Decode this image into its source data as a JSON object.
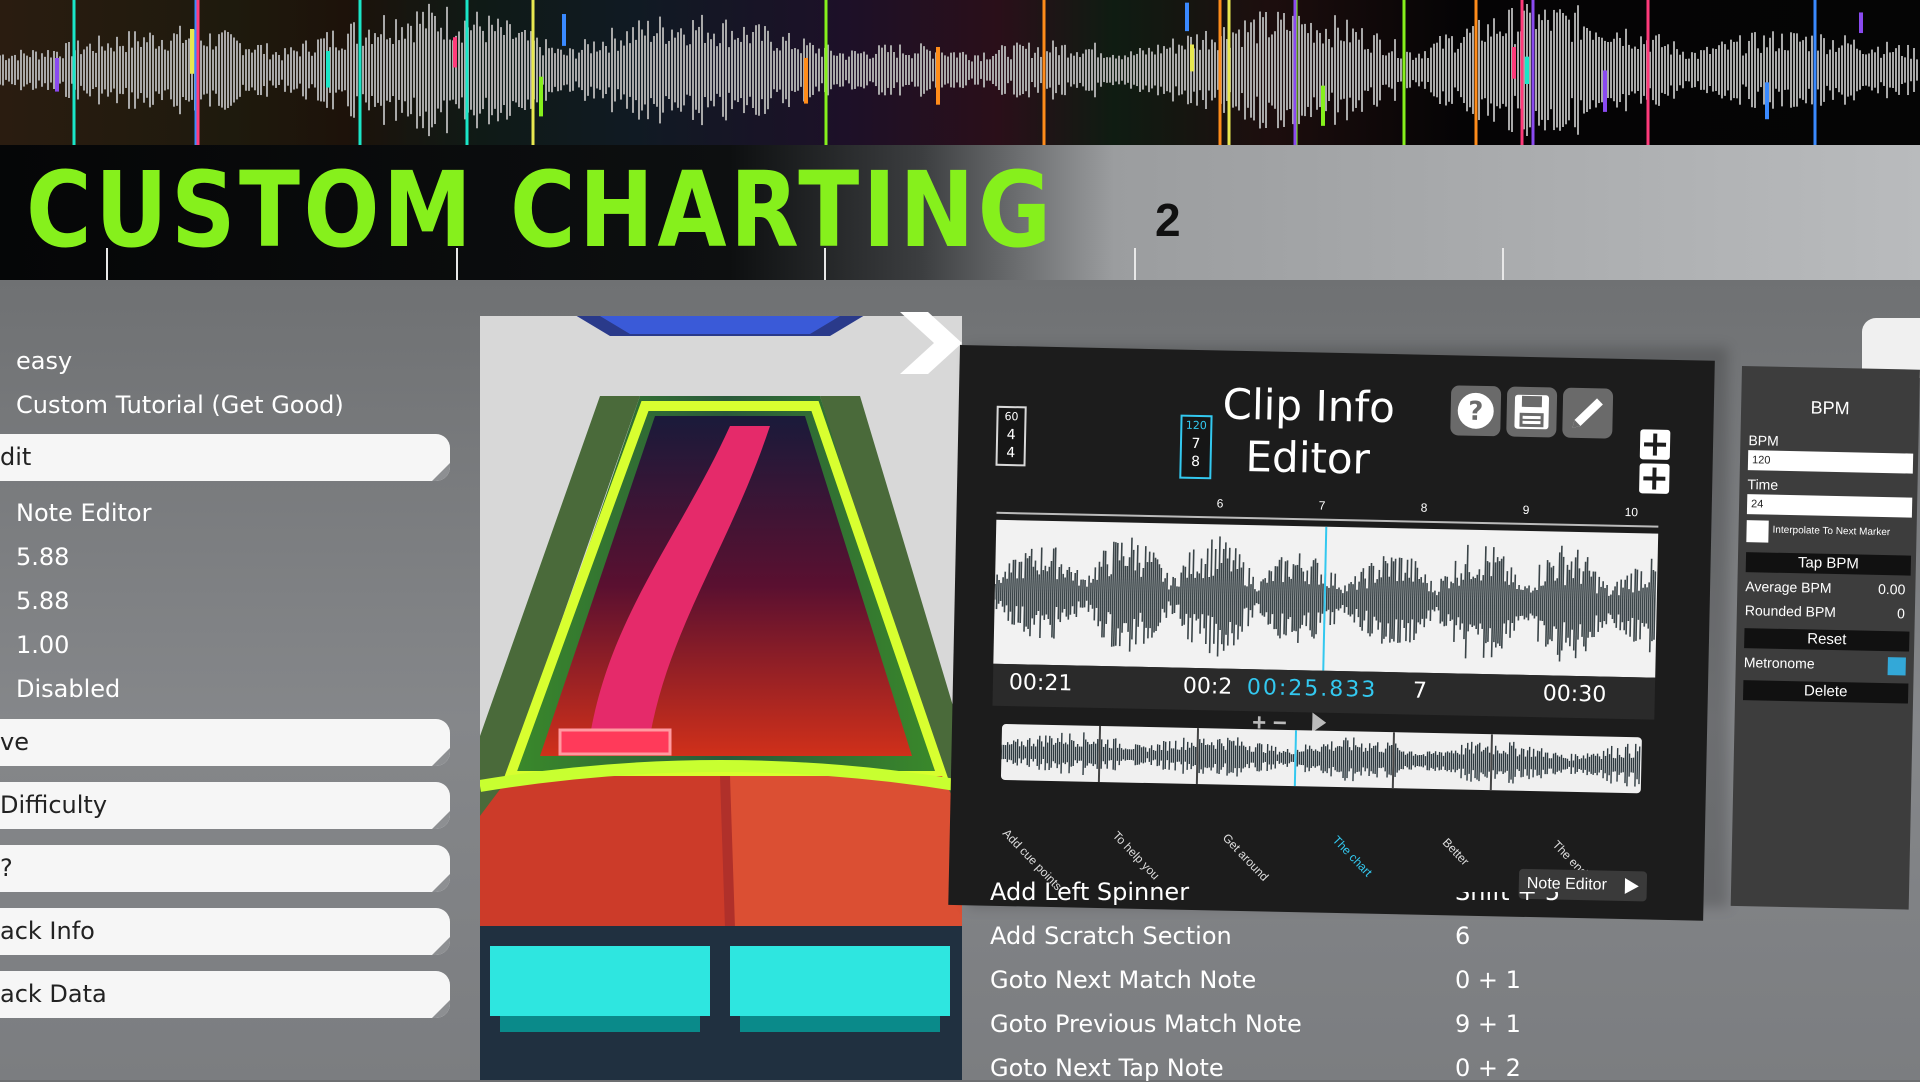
{
  "title": "CUSTOM CHARTING",
  "measure_number": "2",
  "settings": {
    "difficulty_value": "easy",
    "song_name": "Custom Tutorial (Get Good)",
    "edit_button": "dit",
    "note_editor_label": "Note Editor",
    "value1": "5.88",
    "value2": "5.88",
    "value3": "1.00",
    "status": "Disabled",
    "save_button": "ve",
    "difficulty_button": "Difficulty",
    "unknown_button": "?",
    "track_info_button": "ack Info",
    "track_data_button": "ack Data"
  },
  "editor": {
    "title_line1": "Clip Info",
    "title_line2": "Editor",
    "help_icon": "question-icon",
    "save_icon": "save-icon",
    "edit_icon": "pencil-icon",
    "marker1": {
      "bpm": "60",
      "num": "4",
      "den": "4"
    },
    "marker2": {
      "bpm": "120",
      "num": "7",
      "den": "8"
    },
    "ruler_labels": [
      "6",
      "7",
      "8",
      "9",
      "10"
    ],
    "time_left": "00:21",
    "time_mid": "00:2",
    "time_current": "00:25.833",
    "time_mid2": "7",
    "time_right": "00:30",
    "cue_points": [
      "Add cue points",
      "To help you",
      "Get around",
      "The chart",
      "Better",
      "The end"
    ],
    "note_editor_button": "Note Editor"
  },
  "bpm_panel": {
    "header": "BPM",
    "bpm_label": "BPM",
    "bpm_value": "120",
    "time_label": "Time",
    "time_value": "24",
    "interpolate_label": "Interpolate To Next Marker",
    "tap_button": "Tap BPM",
    "average_label": "Average BPM",
    "average_value": "0.00",
    "rounded_label": "Rounded BPM",
    "rounded_value": "0",
    "reset_button": "Reset",
    "metronome_label": "Metronome",
    "delete_button": "Delete"
  },
  "shortcuts": [
    {
      "name": "Add Left Spinner",
      "key": "Shift + 5"
    },
    {
      "name": "Add Scratch Section",
      "key": "6"
    },
    {
      "name": "Goto Next Match Note",
      "key": "0 + 1"
    },
    {
      "name": "Goto Previous Match Note",
      "key": "9 + 1"
    },
    {
      "name": "Goto Next Tap Note",
      "key": "0 + 2"
    }
  ],
  "colors": {
    "title_green": "#86f01c",
    "accent_cyan": "#33c8ef",
    "panel_dark": "#1c1c1c"
  }
}
